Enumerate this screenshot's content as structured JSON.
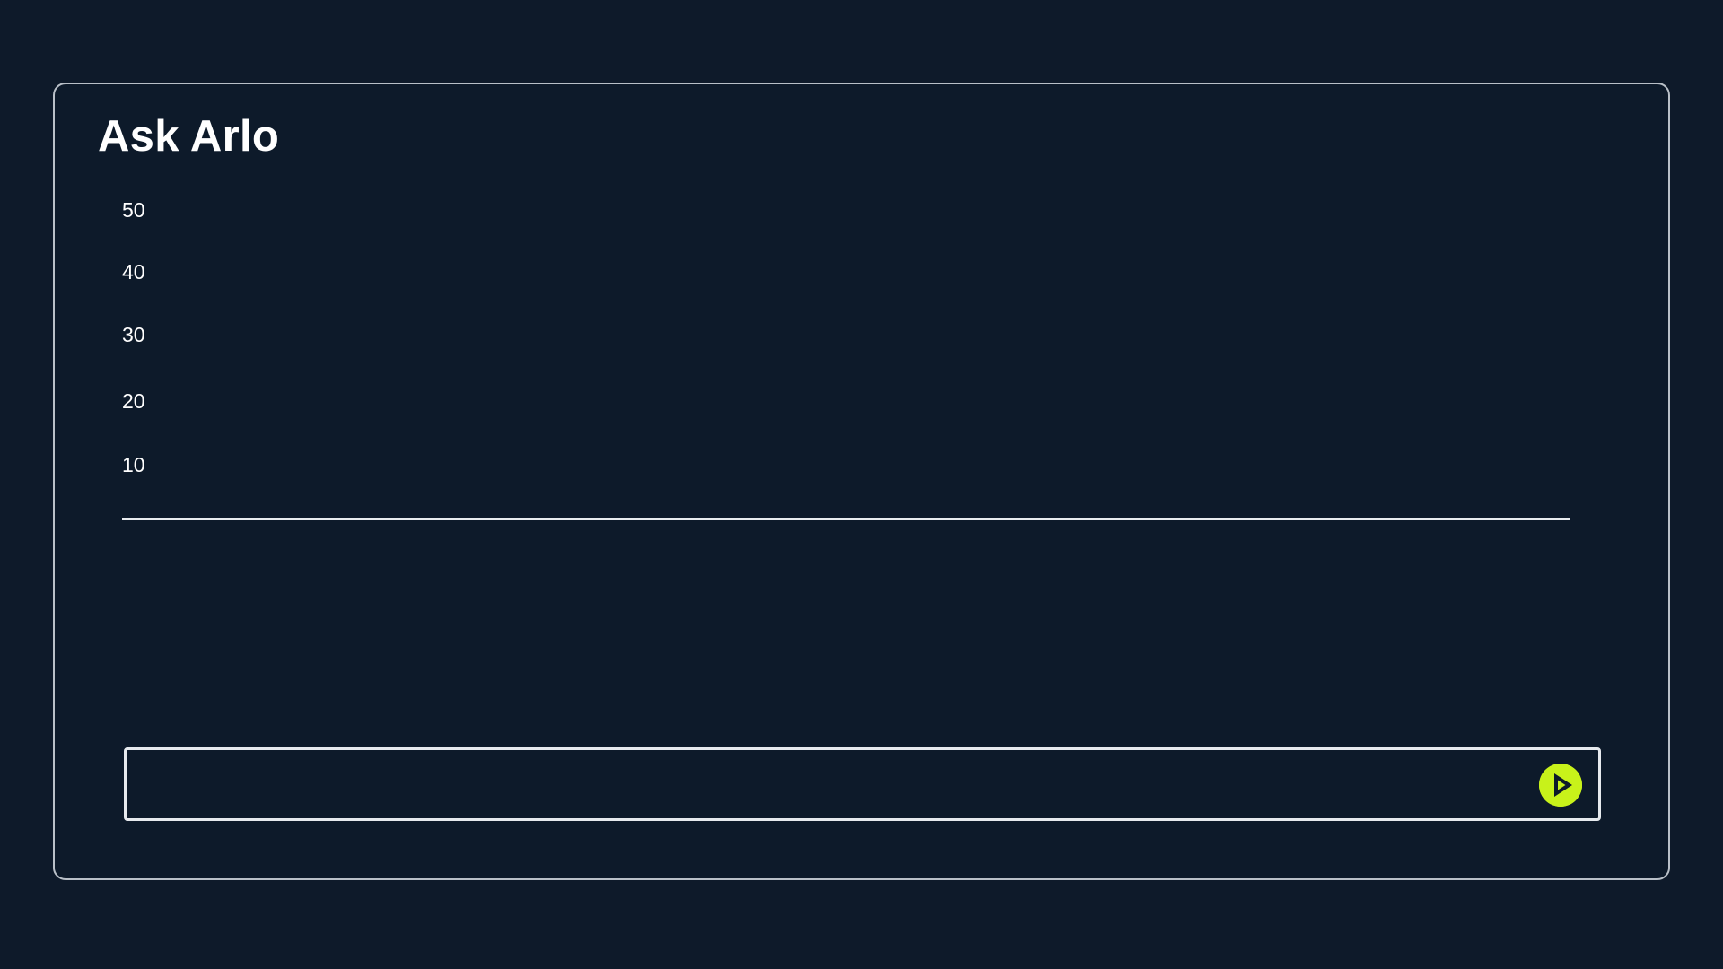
{
  "app": {
    "title": "Ask Arlo"
  },
  "chart_data": {
    "type": "bar",
    "categories": [],
    "values": [],
    "ylim": [
      0,
      50
    ],
    "yticks": [
      "50",
      "40",
      "30",
      "20",
      "10"
    ]
  },
  "prompt": {
    "value": "",
    "placeholder": "",
    "send_icon": "play-icon"
  },
  "colors": {
    "background": "#0e1a2a",
    "accent": "#c8f21a",
    "text": "#ffffff"
  }
}
